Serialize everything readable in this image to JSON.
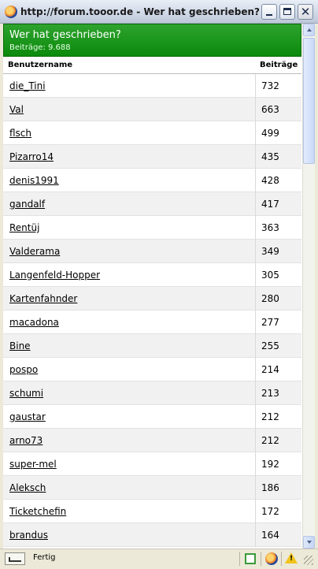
{
  "window": {
    "title": "http://forum.tooor.de - Wer hat geschrieben? ...",
    "icon": "firefox-icon"
  },
  "panel": {
    "heading": "Wer hat geschrieben?",
    "count_label": "Beiträge: 9.688",
    "accent_color": "#0b8a0b"
  },
  "table": {
    "headers": {
      "name": "Benutzername",
      "posts": "Beiträge"
    },
    "rows": [
      {
        "name": "die_Tini",
        "posts": "732"
      },
      {
        "name": "Val",
        "posts": "663"
      },
      {
        "name": "flsch",
        "posts": "499"
      },
      {
        "name": "Pizarro14",
        "posts": "435"
      },
      {
        "name": "denis1991",
        "posts": "428"
      },
      {
        "name": "gandalf",
        "posts": "417"
      },
      {
        "name": "Rentüj",
        "posts": "363"
      },
      {
        "name": "Valderama",
        "posts": "349"
      },
      {
        "name": "Langenfeld-Hopper",
        "posts": "305"
      },
      {
        "name": "Kartenfahnder",
        "posts": "280"
      },
      {
        "name": "macadona",
        "posts": "277"
      },
      {
        "name": "Bine",
        "posts": "255"
      },
      {
        "name": "pospo",
        "posts": "214"
      },
      {
        "name": "schumi",
        "posts": "213"
      },
      {
        "name": "gaustar",
        "posts": "212"
      },
      {
        "name": "arno73",
        "posts": "212"
      },
      {
        "name": "super-mel",
        "posts": "192"
      },
      {
        "name": "Aleksch",
        "posts": "186"
      },
      {
        "name": "Ticketchefin",
        "posts": "172"
      },
      {
        "name": "brandus",
        "posts": "164"
      }
    ]
  },
  "statusbar": {
    "text": "Fertig"
  }
}
